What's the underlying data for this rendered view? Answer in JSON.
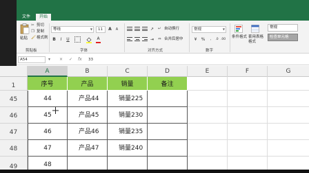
{
  "tabs": {
    "file": "文件",
    "home": "开始"
  },
  "clipboard": {
    "paste": "粘贴",
    "cut": "剪切",
    "copy": "复制",
    "format_painter": "格式刷",
    "group_label": "剪贴板"
  },
  "font": {
    "name": "等线",
    "size": "11",
    "group_label": "字体"
  },
  "alignment": {
    "wrap_text": "自动换行",
    "merge_center": "合并后居中",
    "group_label": "对齐方式"
  },
  "number": {
    "format": "常规",
    "percent": "%",
    "group_label": "数字"
  },
  "styles": {
    "conditional_formatting": "条件格式",
    "format_as_table": "套用表格格式",
    "normal": "常规",
    "check_cell": "检查单元格"
  },
  "formula_bar": {
    "name_box": "A54",
    "cancel": "×",
    "enter": "✓",
    "fx": "fx",
    "value": "33"
  },
  "columns": [
    "A",
    "B",
    "C",
    "D",
    "E",
    "F",
    "G"
  ],
  "rows": [
    {
      "num": "1",
      "cells": [
        "序号",
        "产品",
        "销量",
        "备注"
      ]
    },
    {
      "num": "45",
      "cells": [
        "44",
        "产品44",
        "销量225",
        ""
      ]
    },
    {
      "num": "46",
      "cells": [
        "45",
        "产品45",
        "销量230",
        ""
      ]
    },
    {
      "num": "47",
      "cells": [
        "46",
        "产品46",
        "销量235",
        ""
      ]
    },
    {
      "num": "48",
      "cells": [
        "47",
        "产品47",
        "销量240",
        ""
      ]
    },
    {
      "num": "49",
      "cells": [
        "48",
        "",
        "",
        ""
      ]
    }
  ],
  "colors": {
    "excel_green": "#217346",
    "header_fill": "#92d050"
  }
}
